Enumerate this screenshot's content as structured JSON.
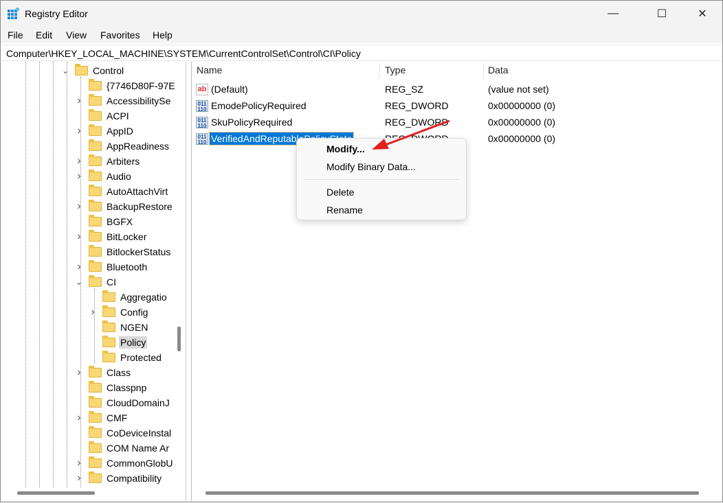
{
  "window": {
    "title": "Registry Editor",
    "minimize": "—",
    "maximize": "☐",
    "close": "✕"
  },
  "menu": [
    "File",
    "Edit",
    "View",
    "Favorites",
    "Help"
  ],
  "address": "Computer\\HKEY_LOCAL_MACHINE\\SYSTEM\\CurrentControlSet\\Control\\CI\\Policy",
  "tree": [
    {
      "label": "Control",
      "level": 0,
      "chevron": "expanded"
    },
    {
      "label": "{7746D80F-97E",
      "level": 1,
      "chevron": "none"
    },
    {
      "label": "AccessibilitySe",
      "level": 1,
      "chevron": "collapsed"
    },
    {
      "label": "ACPI",
      "level": 1,
      "chevron": "none"
    },
    {
      "label": "AppID",
      "level": 1,
      "chevron": "collapsed"
    },
    {
      "label": "AppReadiness",
      "level": 1,
      "chevron": "none"
    },
    {
      "label": "Arbiters",
      "level": 1,
      "chevron": "collapsed"
    },
    {
      "label": "Audio",
      "level": 1,
      "chevron": "collapsed"
    },
    {
      "label": "AutoAttachVirt",
      "level": 1,
      "chevron": "none"
    },
    {
      "label": "BackupRestore",
      "level": 1,
      "chevron": "collapsed"
    },
    {
      "label": "BGFX",
      "level": 1,
      "chevron": "none"
    },
    {
      "label": "BitLocker",
      "level": 1,
      "chevron": "collapsed"
    },
    {
      "label": "BitlockerStatus",
      "level": 1,
      "chevron": "none"
    },
    {
      "label": "Bluetooth",
      "level": 1,
      "chevron": "collapsed"
    },
    {
      "label": "CI",
      "level": 1,
      "chevron": "expanded"
    },
    {
      "label": "Aggregatio",
      "level": 2,
      "chevron": "none"
    },
    {
      "label": "Config",
      "level": 2,
      "chevron": "collapsed"
    },
    {
      "label": "NGEN",
      "level": 2,
      "chevron": "none"
    },
    {
      "label": "Policy",
      "level": 2,
      "chevron": "none",
      "selected": true
    },
    {
      "label": "Protected",
      "level": 2,
      "chevron": "none"
    },
    {
      "label": "Class",
      "level": 1,
      "chevron": "collapsed"
    },
    {
      "label": "Classpnp",
      "level": 1,
      "chevron": "none"
    },
    {
      "label": "CloudDomainJ",
      "level": 1,
      "chevron": "none"
    },
    {
      "label": "CMF",
      "level": 1,
      "chevron": "collapsed"
    },
    {
      "label": "CoDeviceInstal",
      "level": 1,
      "chevron": "none"
    },
    {
      "label": "COM Name Ar",
      "level": 1,
      "chevron": "none"
    },
    {
      "label": "CommonGlobU",
      "level": 1,
      "chevron": "collapsed"
    },
    {
      "label": "Compatibility",
      "level": 1,
      "chevron": "collapsed"
    }
  ],
  "columns": {
    "name": "Name",
    "type": "Type",
    "data": "Data"
  },
  "values": [
    {
      "name": "(Default)",
      "type": "REG_SZ",
      "data": "(value not set)",
      "icon": "string-value-icon"
    },
    {
      "name": "EmodePolicyRequired",
      "type": "REG_DWORD",
      "data": "0x00000000 (0)",
      "icon": "dword-value-icon"
    },
    {
      "name": "SkuPolicyRequired",
      "type": "REG_DWORD",
      "data": "0x00000000 (0)",
      "icon": "dword-value-icon"
    },
    {
      "name": "VerifiedAndReputablePolicyState",
      "type": "REG_DWORD",
      "data": "0x00000000 (0)",
      "icon": "dword-value-icon",
      "selected": true
    }
  ],
  "context_menu": {
    "items": [
      "Modify...",
      "Modify Binary Data...",
      "Delete",
      "Rename"
    ]
  },
  "colors": {
    "selection": "#0078d7",
    "annotation_arrow": "#e02020"
  }
}
